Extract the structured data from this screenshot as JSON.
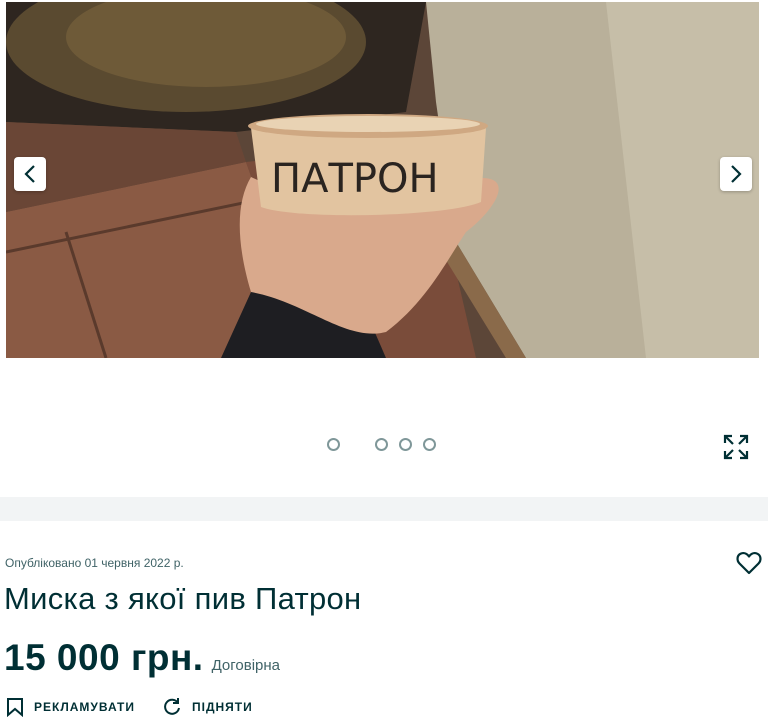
{
  "gallery": {
    "image_alt_text": "ПАТРОН",
    "prev_icon": "chevron-left-icon",
    "next_icon": "chevron-right-icon",
    "expand_icon": "expand-arrows-icon",
    "slide_count": 4
  },
  "listing": {
    "published": "Опубліковано 01 червня 2022 р.",
    "title": "Миска з якої пив Патрон",
    "price": "15 000 грн.",
    "negotiable": "Договірна",
    "favorite_icon": "heart-outline-icon"
  },
  "actions": {
    "promote_label": "РЕКЛАМУВАТИ",
    "promote_icon": "bookmark-icon",
    "raise_label": "ПІДНЯТИ",
    "raise_icon": "refresh-icon"
  },
  "colors": {
    "text_primary": "#002f34",
    "text_secondary": "#406367",
    "band": "#f2f4f5"
  }
}
